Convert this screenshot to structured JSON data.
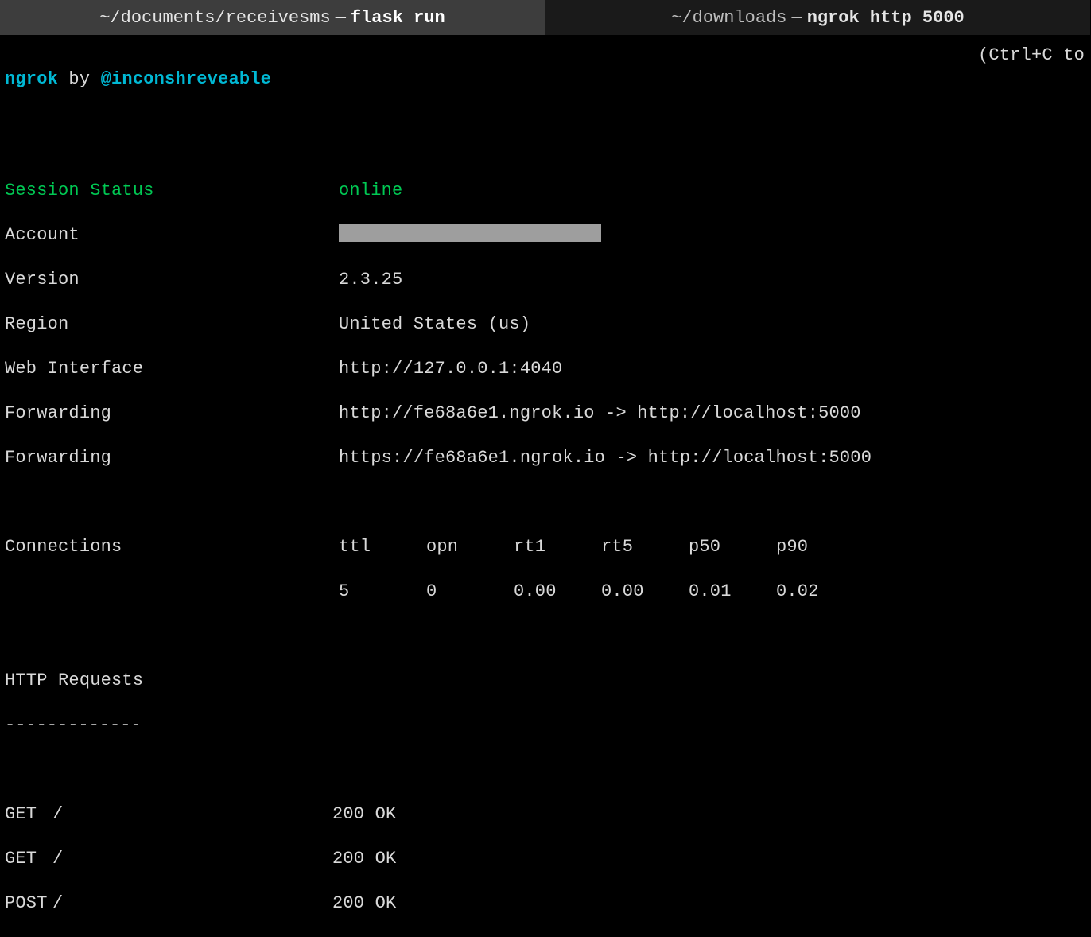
{
  "tabs": [
    {
      "path": "~/documents/receivesms",
      "sep": "—",
      "cmd": "flask run",
      "active": true
    },
    {
      "path": "~/downloads",
      "sep": "—",
      "cmd": "ngrok http 5000",
      "active": false
    }
  ],
  "header": {
    "app": "ngrok",
    "by": " by ",
    "author": "@inconshreveable",
    "hint": "(Ctrl+C to"
  },
  "status": {
    "session_label": "Session Status",
    "session_value": "online",
    "account_label": "Account",
    "account_value": "",
    "version_label": "Version",
    "version_value": "2.3.25",
    "region_label": "Region",
    "region_value": "United States (us)",
    "webif_label": "Web Interface",
    "webif_value": "http://127.0.0.1:4040",
    "fwd1_label": "Forwarding",
    "fwd1_value": "http://fe68a6e1.ngrok.io -> http://localhost:5000",
    "fwd2_label": "Forwarding",
    "fwd2_value": "https://fe68a6e1.ngrok.io -> http://localhost:5000"
  },
  "connections": {
    "label": "Connections",
    "headers": {
      "ttl": "ttl",
      "opn": "opn",
      "rt1": "rt1",
      "rt5": "rt5",
      "p50": "p50",
      "p90": "p90"
    },
    "values": {
      "ttl": "5",
      "opn": "0",
      "rt1": "0.00",
      "rt5": "0.00",
      "p50": "0.01",
      "p90": "0.02"
    }
  },
  "requests": {
    "title": "HTTP Requests",
    "underline": "-------------",
    "rows": [
      {
        "method": "GET",
        "path": "/",
        "status": "200 OK"
      },
      {
        "method": "GET",
        "path": "/",
        "status": "200 OK"
      },
      {
        "method": "POST",
        "path": "/",
        "status": "200 OK"
      }
    ]
  }
}
